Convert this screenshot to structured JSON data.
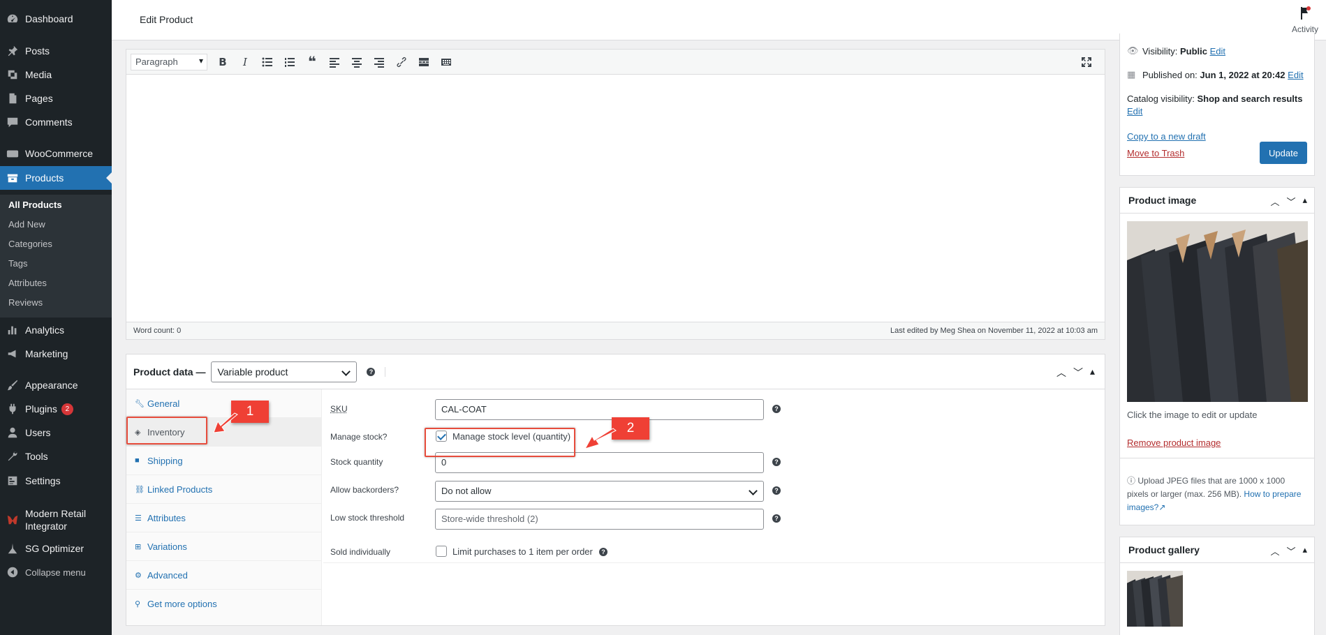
{
  "sidebar": {
    "items": [
      {
        "label": "Dashboard",
        "icon": "dashboard-icon"
      },
      {
        "label": "Posts",
        "icon": "pin-icon"
      },
      {
        "label": "Media",
        "icon": "media-icon"
      },
      {
        "label": "Pages",
        "icon": "pages-icon"
      },
      {
        "label": "Comments",
        "icon": "comments-icon"
      },
      {
        "label": "WooCommerce",
        "icon": "woocommerce-icon"
      },
      {
        "label": "Products",
        "icon": "products-icon"
      },
      {
        "label": "Analytics",
        "icon": "analytics-icon"
      },
      {
        "label": "Marketing",
        "icon": "marketing-icon"
      },
      {
        "label": "Appearance",
        "icon": "brush-icon"
      },
      {
        "label": "Plugins",
        "icon": "plugins-icon",
        "badge": "2"
      },
      {
        "label": "Users",
        "icon": "users-icon"
      },
      {
        "label": "Tools",
        "icon": "wrench-icon"
      },
      {
        "label": "Settings",
        "icon": "settings-icon"
      },
      {
        "label": "Modern Retail Integrator",
        "icon": "modern-retail-icon"
      },
      {
        "label": "SG Optimizer",
        "icon": "sg-optimizer-icon"
      },
      {
        "label": "Collapse menu",
        "icon": "collapse-icon"
      }
    ],
    "submenu": [
      "All Products",
      "Add New",
      "Categories",
      "Tags",
      "Attributes",
      "Reviews"
    ]
  },
  "header": {
    "title": "Edit Product",
    "activity_label": "Activity"
  },
  "editor": {
    "format_select": "Paragraph",
    "word_count": "Word count: 0",
    "last_edited": "Last edited by Meg Shea on November 11, 2022 at 10:03 am"
  },
  "product_data": {
    "title": "Product data —",
    "product_type": "Variable product",
    "tabs": [
      "General",
      "Inventory",
      "Shipping",
      "Linked Products",
      "Attributes",
      "Variations",
      "Advanced",
      "Get more options"
    ],
    "active_tab": "Inventory",
    "fields": {
      "sku_label": "SKU",
      "sku_value": "CAL-COAT",
      "manage_stock_label": "Manage stock?",
      "manage_stock_checkbox_label": "Manage stock level (quantity)",
      "stock_qty_label": "Stock quantity",
      "stock_qty_value": "0",
      "backorders_label": "Allow backorders?",
      "backorders_value": "Do not allow",
      "low_stock_label": "Low stock threshold",
      "low_stock_placeholder": "Store-wide threshold (2)",
      "sold_individually_label": "Sold individually",
      "sold_individually_checkbox_label": "Limit purchases to 1 item per order"
    }
  },
  "annotations": {
    "step1": "1",
    "step2": "2",
    "color": "#ef4035"
  },
  "publish": {
    "visibility_label": "Visibility:",
    "visibility_value": "Public",
    "published_label": "Published on:",
    "published_value": "Jun 1, 2022 at 20:42",
    "edit_link": "Edit",
    "catalog_label": "Catalog visibility:",
    "catalog_value": "Shop and search results",
    "copy_draft": "Copy to a new draft",
    "move_trash": "Move to Trash",
    "update_button": "Update"
  },
  "product_image": {
    "title": "Product image",
    "click_hint": "Click the image to edit or update",
    "remove_link": "Remove product image",
    "upload_hint": "Upload JPEG files that are 1000 x 1000 pixels or larger (max. 256 MB).",
    "how_to_link": "How to prepare images?"
  },
  "product_gallery": {
    "title": "Product gallery"
  },
  "colors": {
    "sidebar_bg": "#1d2327",
    "accent": "#2271b1",
    "danger": "#b32d2e"
  }
}
